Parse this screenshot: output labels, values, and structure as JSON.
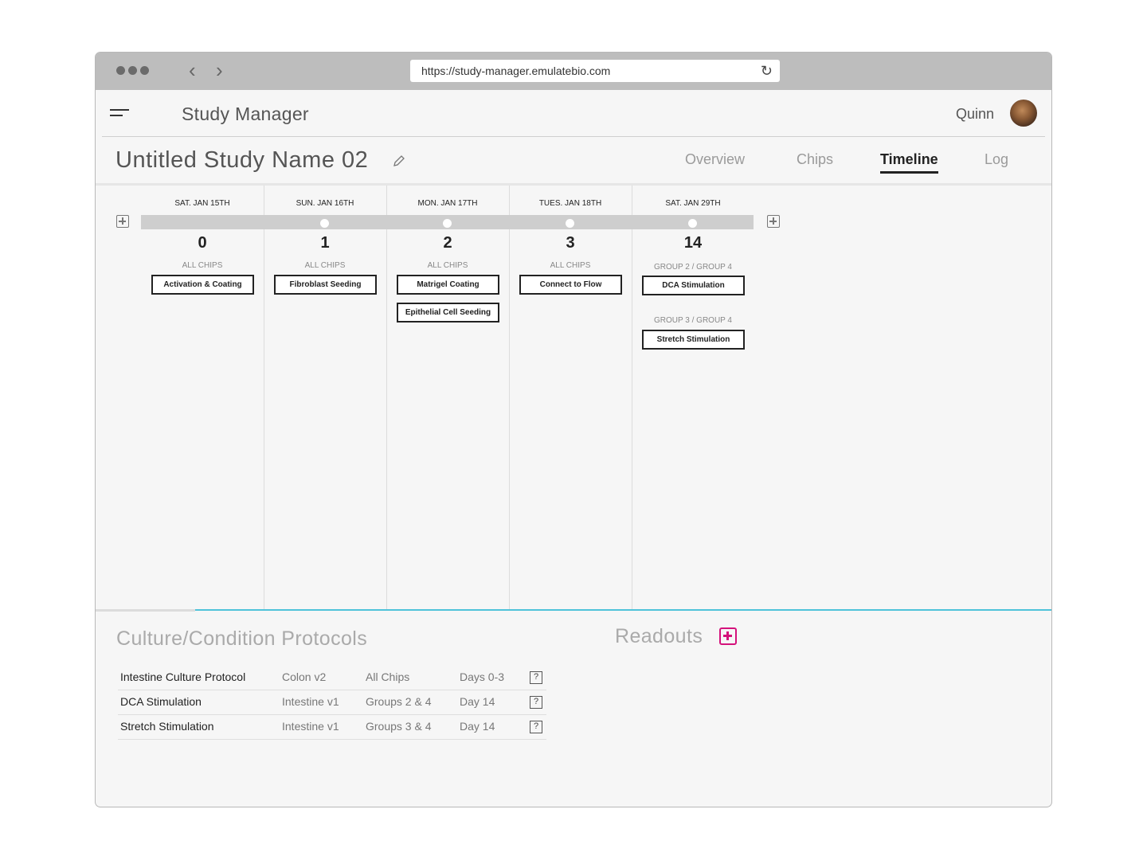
{
  "browser": {
    "url": "https://study-manager.emulatebio.com"
  },
  "app": {
    "title": "Study Manager",
    "user": "Quinn"
  },
  "study": {
    "title": "Untitled Study Name 02",
    "tabs": [
      {
        "label": "Overview",
        "active": false
      },
      {
        "label": "Chips",
        "active": false
      },
      {
        "label": "Timeline",
        "active": true
      },
      {
        "label": "Log",
        "active": false
      }
    ]
  },
  "timeline": {
    "days": [
      {
        "date": "SAT. JAN 15TH",
        "day": "0",
        "groups": [
          {
            "label": "ALL CHIPS",
            "protocols": [
              "Activation & Coating"
            ]
          }
        ]
      },
      {
        "date": "SUN. JAN 16TH",
        "day": "1",
        "groups": [
          {
            "label": "ALL CHIPS",
            "protocols": [
              "Fibroblast Seeding"
            ]
          }
        ]
      },
      {
        "date": "MON. JAN 17TH",
        "day": "2",
        "groups": [
          {
            "label": "ALL CHIPS",
            "protocols": [
              "Matrigel Coating",
              "Epithelial Cell Seeding"
            ]
          }
        ]
      },
      {
        "date": "TUES. JAN 18TH",
        "day": "3",
        "groups": [
          {
            "label": "ALL CHIPS",
            "protocols": [
              "Connect to Flow"
            ]
          }
        ]
      },
      {
        "date": "SAT. JAN 29TH",
        "day": "14",
        "groups": [
          {
            "label": "GROUP 2 / GROUP 4",
            "protocols": [
              "DCA Stimulation"
            ]
          },
          {
            "label": "GROUP 3 / GROUP 4",
            "protocols": [
              "Stretch Stimulation"
            ]
          }
        ]
      }
    ]
  },
  "protocols_section": {
    "title": "Culture/Condition Protocols",
    "rows": [
      {
        "name": "Intestine Culture Protocol",
        "model": "Colon v2",
        "chips": "All Chips",
        "days": "Days 0-3",
        "help": "?"
      },
      {
        "name": "DCA Stimulation",
        "model": "Intestine v1",
        "chips": "Groups 2 & 4",
        "days": "Day 14",
        "help": "?"
      },
      {
        "name": "Stretch Stimulation",
        "model": "Intestine v1",
        "chips": "Groups 3 & 4",
        "days": "Day 14",
        "help": "?"
      }
    ]
  },
  "readouts_section": {
    "title": "Readouts"
  },
  "colors": {
    "accent_teal": "#4fc3d9",
    "accent_magenta": "#d4127b"
  }
}
